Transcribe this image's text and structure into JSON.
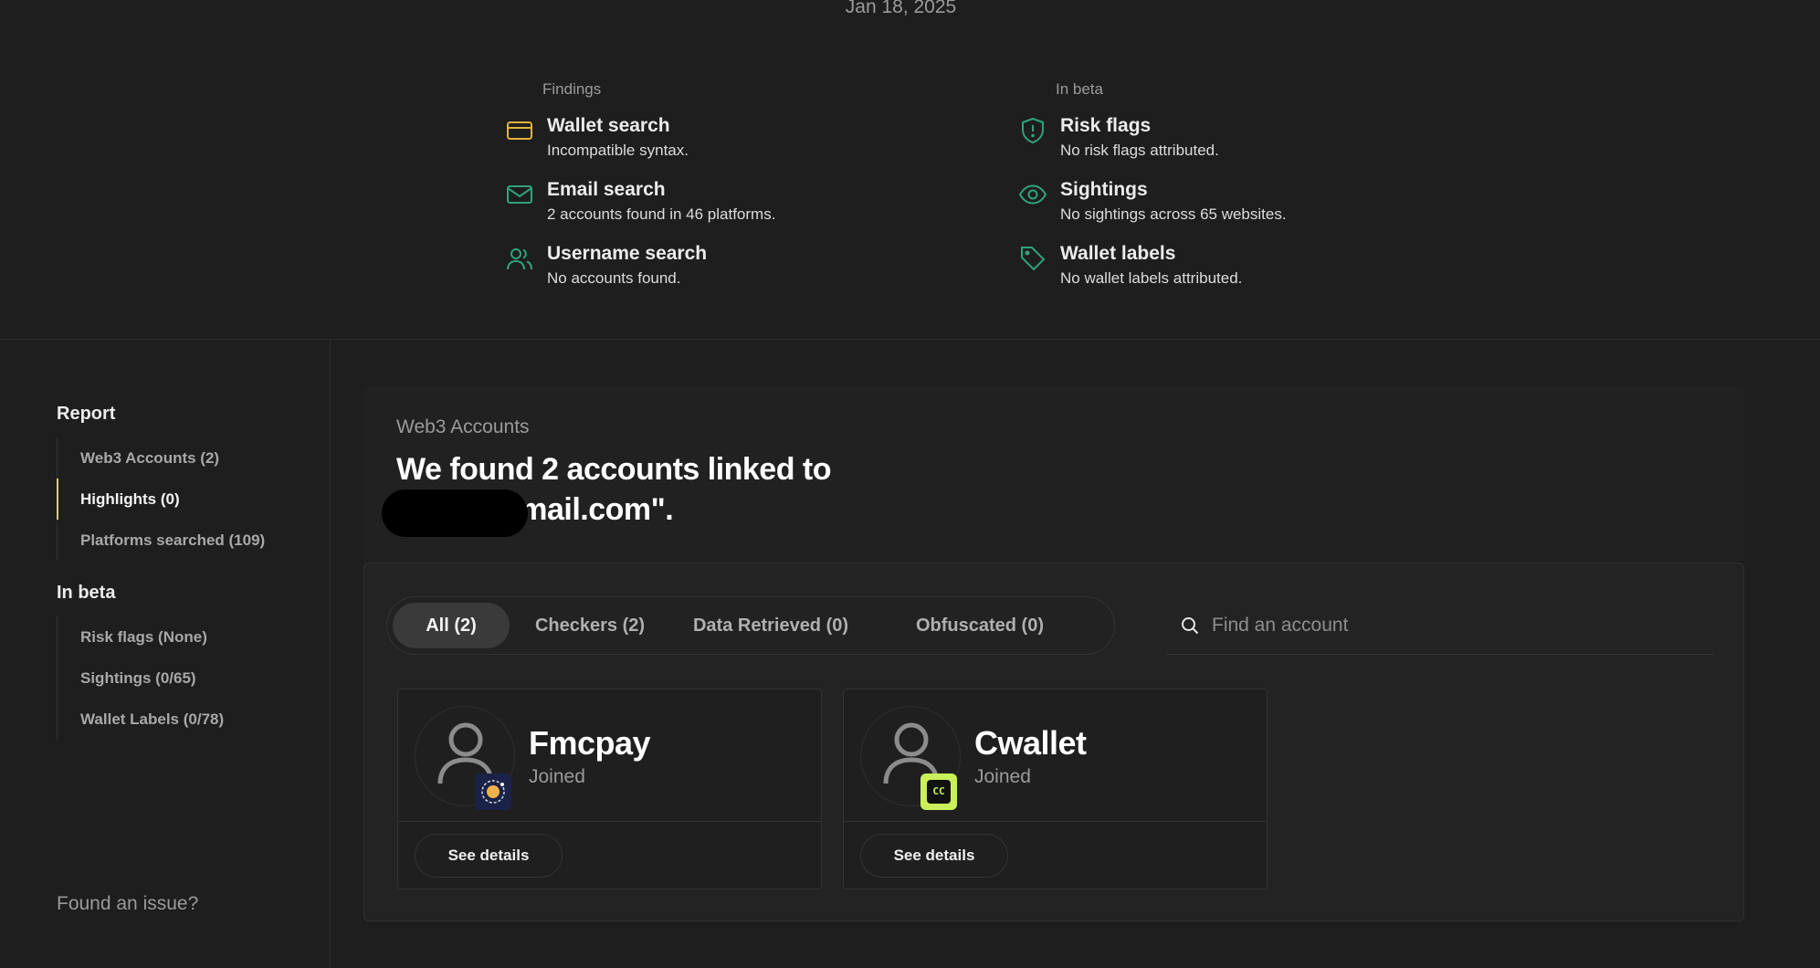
{
  "header": {
    "date": "Jan 18, 2025"
  },
  "findings": {
    "heading": "Findings",
    "items": [
      {
        "title": "Wallet search",
        "subtitle": "Incompatible syntax.",
        "icon": "credit-card-icon",
        "color": "#e2b33c"
      },
      {
        "title": "Email search",
        "subtitle": "2 accounts found in 46 platforms.",
        "icon": "mail-icon",
        "color": "#2fa37c"
      },
      {
        "title": "Username search",
        "subtitle": "No accounts found.",
        "icon": "users-icon",
        "color": "#2fa37c"
      }
    ]
  },
  "beta": {
    "heading": "In beta",
    "items": [
      {
        "title": "Risk flags",
        "subtitle": "No risk flags attributed.",
        "icon": "shield-alert-icon",
        "color": "#2fa37c"
      },
      {
        "title": "Sightings",
        "subtitle": "No sightings across 65 websites.",
        "icon": "eye-icon",
        "color": "#2fa37c"
      },
      {
        "title": "Wallet labels",
        "subtitle": "No wallet labels attributed.",
        "icon": "tag-icon",
        "color": "#2fa37c"
      }
    ]
  },
  "sidebar": {
    "report_heading": "Report",
    "report_items": [
      {
        "label": "Web3 Accounts (2)",
        "active": false
      },
      {
        "label": "Highlights (0)",
        "active": true
      },
      {
        "label": "Platforms searched (109)",
        "active": false
      }
    ],
    "beta_heading": "In beta",
    "beta_items": [
      {
        "label": "Risk flags (None)"
      },
      {
        "label": "Sightings (0/65)"
      },
      {
        "label": "Wallet Labels (0/78)"
      }
    ],
    "footer_link": "Found an issue?"
  },
  "main": {
    "kicker": "Web3 Accounts",
    "headline_line1": "We found 2 accounts linked to",
    "headline_line2": "gmail.com\".",
    "tabs": [
      {
        "label": "All (2)",
        "active": true
      },
      {
        "label": "Checkers (2)",
        "active": false
      },
      {
        "label": "Data Retrieved (0)",
        "active": false
      },
      {
        "label": "Obfuscated (0)",
        "active": false
      }
    ],
    "search": {
      "placeholder": "Find an account",
      "value": ""
    },
    "cards": [
      {
        "name": "Fmcpay",
        "status": "Joined",
        "button": "See details",
        "logo_icon": "fmcpay-logo-icon"
      },
      {
        "name": "Cwallet",
        "status": "Joined",
        "button": "See details",
        "logo_icon": "cwallet-logo-icon",
        "logo_text": "CC"
      }
    ]
  },
  "colors": {
    "background": "#1e1e1e",
    "accent_green": "#2fa37c",
    "accent_yellow": "#e2b33c",
    "active_marker": "#d9d06a"
  }
}
